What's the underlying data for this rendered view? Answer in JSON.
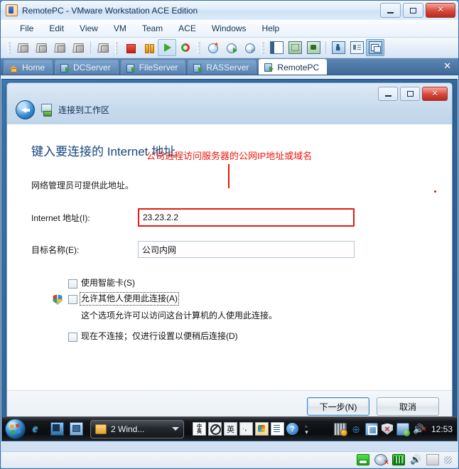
{
  "window": {
    "title": "RemotePC - VMware Workstation ACE Edition",
    "app_icon": "vmware-icon",
    "controls": {
      "minimize": "minimize-icon",
      "maximize": "maximize-icon",
      "close": "close-icon"
    }
  },
  "menubar": {
    "items": [
      {
        "label": "File"
      },
      {
        "label": "Edit"
      },
      {
        "label": "View"
      },
      {
        "label": "VM"
      },
      {
        "label": "Team"
      },
      {
        "label": "ACE"
      },
      {
        "label": "Windows"
      },
      {
        "label": "Help"
      }
    ]
  },
  "toolbar": {
    "groups": [
      {
        "buttons": [
          {
            "icon": "virtual-machine-icon"
          },
          {
            "icon": "virtual-machine-clone-icon"
          },
          {
            "icon": "virtual-machine-delete-icon"
          },
          {
            "icon": "virtual-machine-usb-icon"
          }
        ]
      },
      {
        "buttons": [
          {
            "icon": "open-vm-icon"
          }
        ]
      },
      {
        "buttons": [
          {
            "icon": "power-off-icon"
          },
          {
            "icon": "suspend-icon"
          },
          {
            "icon": "power-on-icon",
            "state": "enabled"
          },
          {
            "icon": "reset-icon"
          }
        ]
      },
      {
        "buttons": [
          {
            "icon": "take-snapshot-icon"
          },
          {
            "icon": "revert-snapshot-icon"
          },
          {
            "icon": "snapshot-manager-icon"
          }
        ]
      },
      {
        "buttons": [
          {
            "icon": "show-sidebar-icon"
          },
          {
            "icon": "fullscreen-icon"
          },
          {
            "icon": "unity-mode-icon"
          }
        ]
      },
      {
        "buttons": [
          {
            "icon": "preferences-icon"
          },
          {
            "icon": "summary-view-icon"
          },
          {
            "icon": "console-view-icon",
            "state": "pressed"
          }
        ]
      }
    ]
  },
  "tabs": {
    "items": [
      {
        "label": "Home",
        "icon": "home-icon",
        "active": false
      },
      {
        "label": "DCServer",
        "icon": "vm-tab-icon",
        "active": false
      },
      {
        "label": "FileServer",
        "icon": "vm-tab-icon",
        "active": false
      },
      {
        "label": "RASServer",
        "icon": "vm-tab-icon",
        "active": false
      },
      {
        "label": "RemotePC",
        "icon": "vm-tab-icon",
        "active": true
      }
    ],
    "close_label": "✕"
  },
  "wizard": {
    "titlebar_icon": "connect-workspace-icon",
    "title": "连接到工作区",
    "back_label": "back-arrow-icon",
    "controls": {
      "minimize": "minimize-icon",
      "maximize": "maximize-icon",
      "close": "close-icon"
    },
    "page_heading": "键入要连接的 Internet 地址",
    "hint": "网络管理员可提供此地址。",
    "annotation": "公司远程访问服务器的公网IP地址或域名",
    "annotation_color": "#f01208",
    "fields": [
      {
        "label": "Internet 地址(I):",
        "value": "23.23.2.2",
        "highlighted": true
      },
      {
        "label": "目标名称(E):",
        "value": "公司内网",
        "highlighted": false
      }
    ],
    "checkboxes": [
      {
        "label": "使用智能卡(S)",
        "checked": false,
        "shield": false,
        "focused": false,
        "description": ""
      },
      {
        "label": "允许其他人使用此连接(A)",
        "checked": false,
        "shield": true,
        "focused": true,
        "description": "这个选项允许可以访问这台计算机的人使用此连接。"
      },
      {
        "label": "现在不连接；仅进行设置以便稍后连接(D)",
        "checked": false,
        "shield": false,
        "focused": false,
        "description": ""
      }
    ],
    "buttons": {
      "next": "下一步(N)",
      "cancel": "取消"
    }
  },
  "guest_taskbar": {
    "start_icon": "windows-start-orb",
    "quick_launch": [
      {
        "icon": "internet-explorer-icon",
        "glyph": "e"
      },
      {
        "icon": "show-desktop-icon"
      },
      {
        "icon": "switch-windows-icon"
      }
    ],
    "task_button": {
      "label": "2 Wind...",
      "icon": "folder-icon",
      "caret": "chevron-down-icon"
    },
    "ime": [
      {
        "icon": "ime-logo-icon",
        "line1": "中",
        "line2": "英"
      },
      {
        "icon": "ime-disabled-icon"
      },
      {
        "icon": "ime-language-icon",
        "glyph": "英"
      },
      {
        "icon": "ime-punctuation-icon",
        "glyph": "·，"
      },
      {
        "icon": "ime-handwriting-icon"
      },
      {
        "icon": "ime-softkeyboard-icon"
      },
      {
        "icon": "ime-help-icon"
      },
      {
        "icon": "ime-expand-icon"
      }
    ],
    "tray": [
      {
        "icon": "keyboard-tray-icon"
      },
      {
        "icon": "network-connections-icon"
      },
      {
        "icon": "vmware-tools-icon"
      },
      {
        "icon": "security-alert-shield-icon"
      },
      {
        "icon": "network-status-icon"
      },
      {
        "icon": "volume-muted-icon"
      }
    ],
    "clock": "12:53"
  },
  "status_bar": {
    "items": [
      {
        "icon": "hard-disk-status-icon"
      },
      {
        "icon": "cd-dvd-disconnected-icon"
      },
      {
        "icon": "network-adapter-status-icon"
      },
      {
        "icon": "sound-adapter-status-icon"
      },
      {
        "icon": "printer-status-icon"
      }
    ],
    "resize_grip": "resize-grip-icon"
  }
}
